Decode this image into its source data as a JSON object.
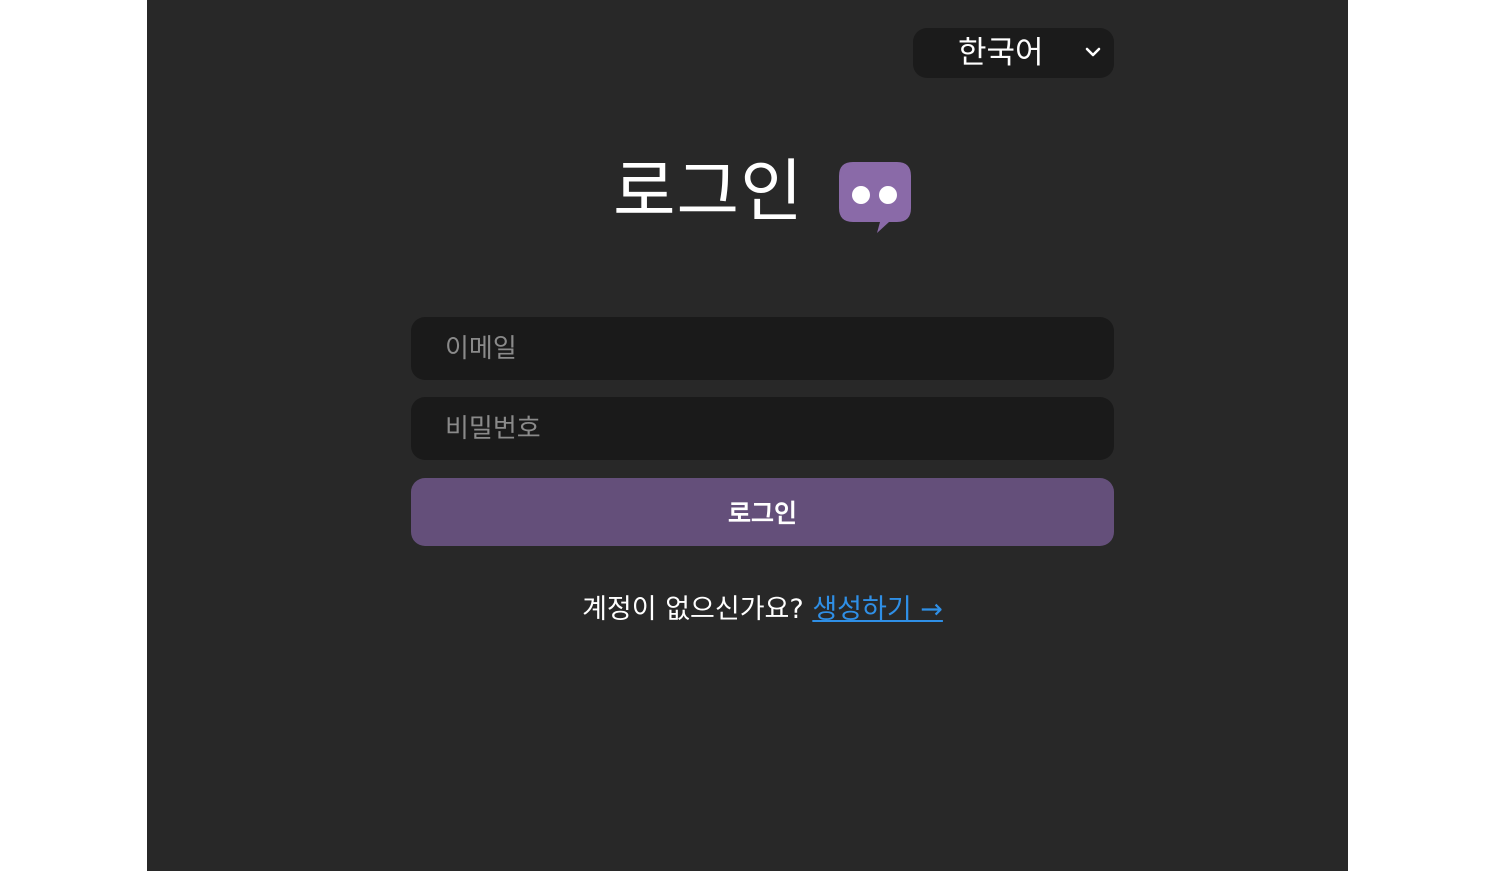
{
  "language_select": {
    "selected": "한국어",
    "icon": "chevron-down-icon"
  },
  "header": {
    "title": "로그인",
    "logo_icon": "speech-bubble-eyes-icon",
    "logo_color": "#8a6aa8"
  },
  "form": {
    "email_placeholder": "이메일",
    "password_placeholder": "비밀번호",
    "submit_label": "로그인",
    "submit_color": "#644f7a"
  },
  "signup": {
    "prompt": "계정이 없으신가요?",
    "link_label": "생성하기 →",
    "link_color": "#2f8fe6"
  }
}
